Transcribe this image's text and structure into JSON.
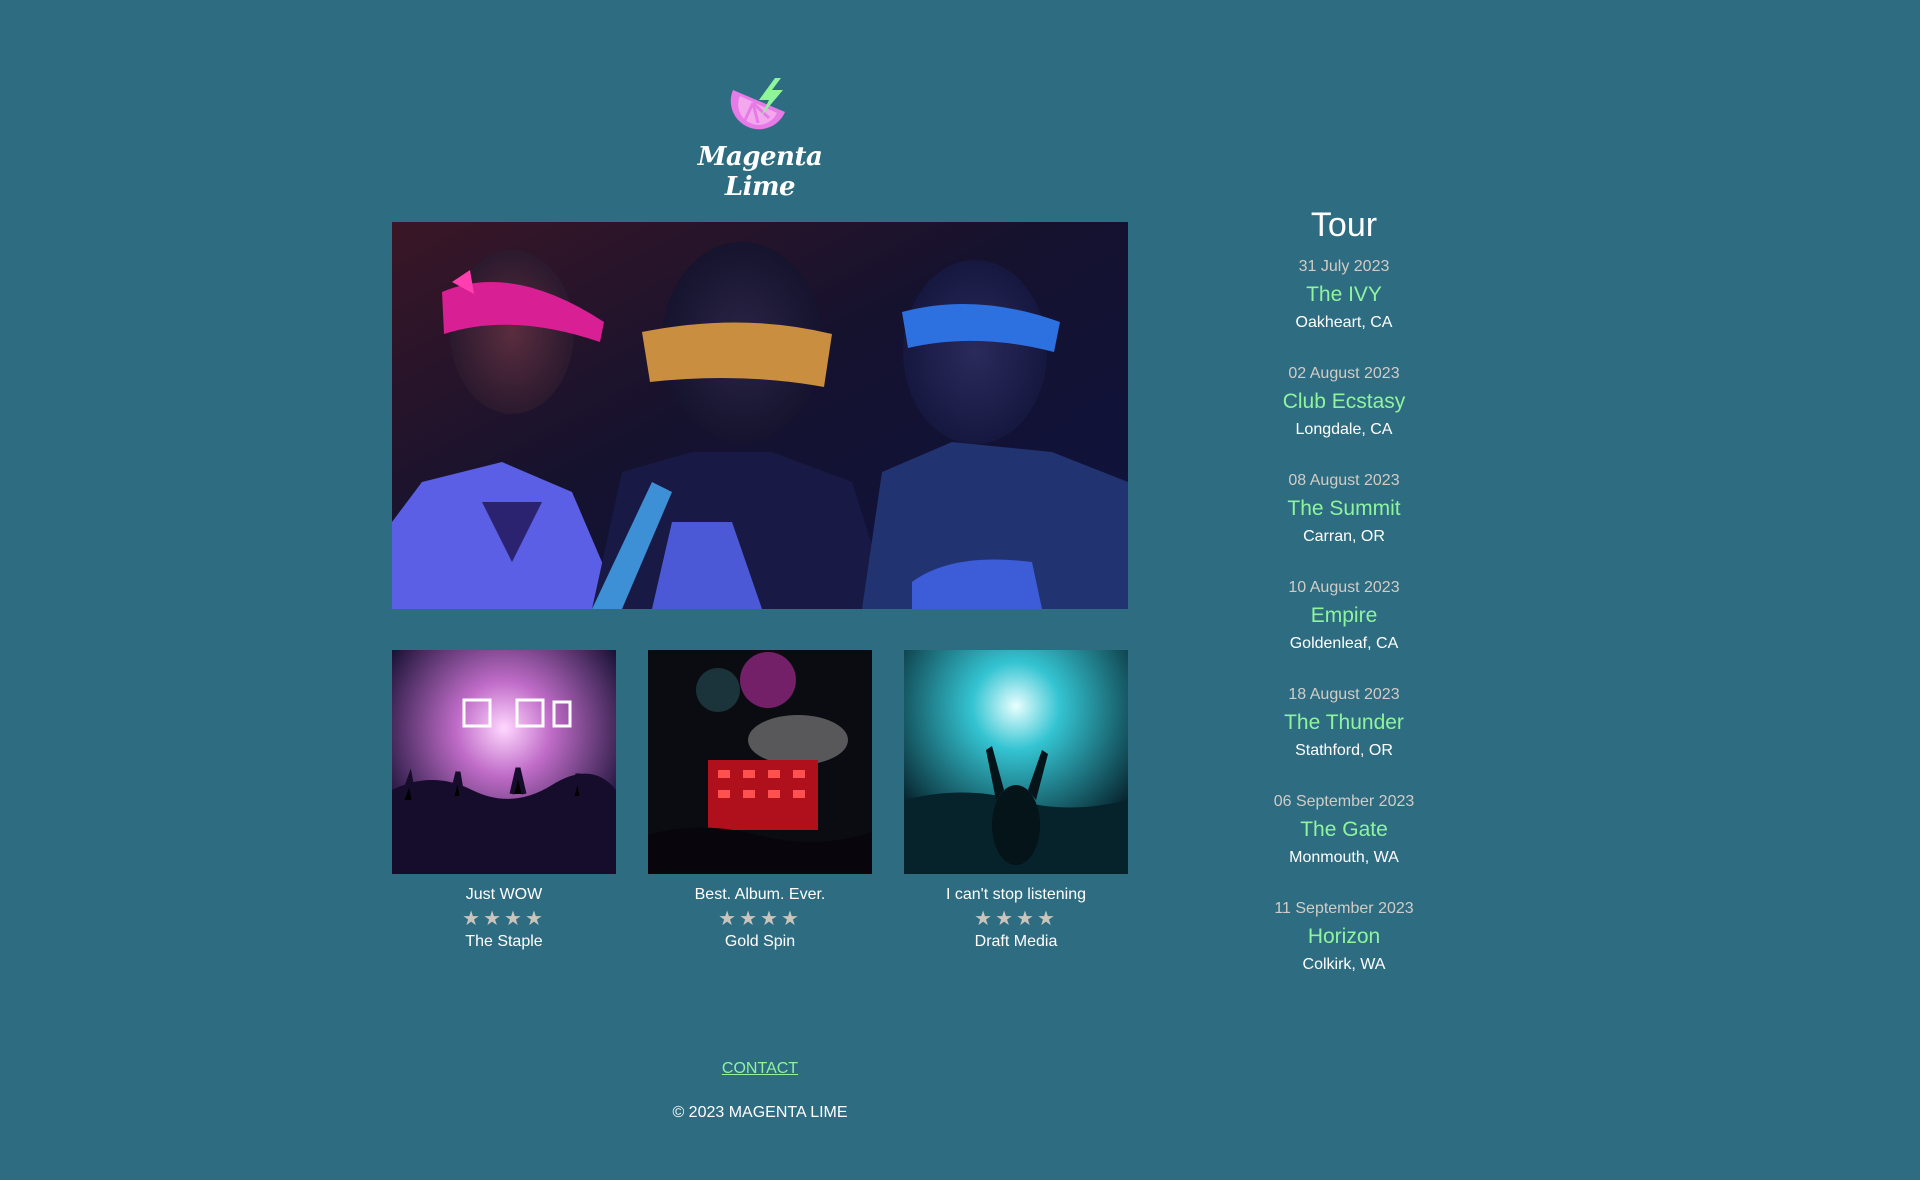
{
  "brand": {
    "name": "Magenta Lime",
    "logo_icon": "lime-slice-lightning-icon",
    "colors": {
      "magenta": "#e67ae6",
      "lime": "#8ef59d"
    }
  },
  "colors": {
    "background": "#2e6c82",
    "accent": "#8ef59d",
    "muted_text": "#d1ccc6",
    "star": "#c9c4bd"
  },
  "hero": {
    "image": "band-three-blindfolded-members-photo"
  },
  "reviews": [
    {
      "image": "concert-crowd-pink-lights-photo",
      "quote": "Just WOW",
      "rating": 4,
      "source": "The Staple"
    },
    {
      "image": "concert-fireworks-red-stage-photo",
      "quote": "Best. Album. Ever.",
      "rating": 4,
      "source": "Gold Spin"
    },
    {
      "image": "concert-crowd-cyan-lights-photo",
      "quote": "I can't stop listening",
      "rating": 4,
      "source": "Draft Media"
    }
  ],
  "tour": {
    "title": "Tour",
    "shows": [
      {
        "date": "31 July 2023",
        "venue": "The IVY",
        "city": "Oakheart, CA"
      },
      {
        "date": "02 August 2023",
        "venue": "Club Ecstasy",
        "city": "Longdale, CA"
      },
      {
        "date": "08 August 2023",
        "venue": "The Summit",
        "city": "Carran, OR"
      },
      {
        "date": "10 August 2023",
        "venue": "Empire",
        "city": "Goldenleaf, CA"
      },
      {
        "date": "18 August 2023",
        "venue": "The Thunder",
        "city": "Stathford, OR"
      },
      {
        "date": "06 September 2023",
        "venue": "The Gate",
        "city": "Monmouth, WA"
      },
      {
        "date": "11 September 2023",
        "venue": "Horizon",
        "city": "Colkirk, WA"
      }
    ]
  },
  "footer": {
    "contact_label": "CONTACT",
    "copyright": "© 2023 MAGENTA LIME"
  }
}
